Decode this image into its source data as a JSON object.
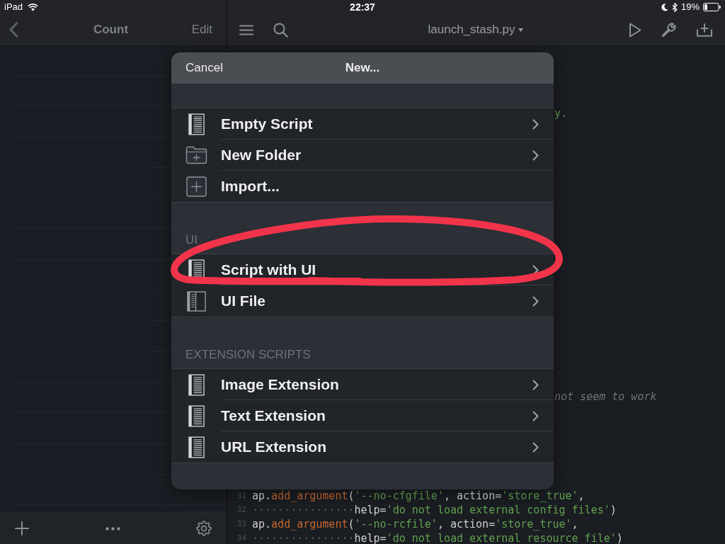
{
  "status_bar": {
    "device": "iPad",
    "time": "22:37",
    "battery": "19%"
  },
  "sidebar": {
    "title": "Count",
    "edit_button": "Edit"
  },
  "editor": {
    "file_name": "launch_stash.py",
    "fragments": [
      {
        "tokens": [
          {
            "text": "y.",
            "kind": "string"
          }
        ]
      },
      {
        "tokens": [
          {
            "text": "not seem to work",
            "kind": "comment"
          }
        ]
      }
    ],
    "lines": [
      {
        "number": "31",
        "tokens": [
          {
            "text": "ap.",
            "kind": "plain"
          },
          {
            "text": "add_argument",
            "kind": "func"
          },
          {
            "text": "(",
            "kind": "plain"
          },
          {
            "text": "'--no-cfgfile'",
            "kind": "string"
          },
          {
            "text": ", action=",
            "kind": "plain"
          },
          {
            "text": "'store_true'",
            "kind": "string"
          },
          {
            "text": ",",
            "kind": "plain"
          }
        ]
      },
      {
        "number": "32",
        "tokens": [
          {
            "text": "················",
            "kind": "whitespace"
          },
          {
            "text": "help=",
            "kind": "plain"
          },
          {
            "text": "'do not load external config files'",
            "kind": "string"
          },
          {
            "text": ")",
            "kind": "plain"
          }
        ]
      },
      {
        "number": "33",
        "tokens": [
          {
            "text": "ap.",
            "kind": "plain"
          },
          {
            "text": "add_argument",
            "kind": "func"
          },
          {
            "text": "(",
            "kind": "plain"
          },
          {
            "text": "'--no-rcfile'",
            "kind": "string"
          },
          {
            "text": ", action=",
            "kind": "plain"
          },
          {
            "text": "'store_true'",
            "kind": "string"
          },
          {
            "text": ",",
            "kind": "plain"
          }
        ]
      },
      {
        "number": "34",
        "tokens": [
          {
            "text": "················",
            "kind": "whitespace"
          },
          {
            "text": "help=",
            "kind": "plain"
          },
          {
            "text": "'do not load external resource file'",
            "kind": "string"
          },
          {
            "text": ")",
            "kind": "plain"
          }
        ]
      }
    ]
  },
  "dialog": {
    "cancel_button": "Cancel",
    "title": "New...",
    "sections": [
      {
        "items": [
          {
            "label": "Empty Script",
            "kind": "script",
            "disclosure": true
          },
          {
            "label": "New Folder",
            "kind": "folder",
            "disclosure": true
          },
          {
            "label": "Import...",
            "kind": "import",
            "disclosure": false
          }
        ]
      },
      {
        "header": "UI",
        "items": [
          {
            "label": "Script with UI",
            "kind": "script",
            "disclosure": true
          },
          {
            "label": "UI File",
            "kind": "ui_file",
            "disclosure": true
          }
        ]
      },
      {
        "header": "EXTENSION SCRIPTS",
        "items": [
          {
            "label": "Image Extension",
            "kind": "script",
            "disclosure": true
          },
          {
            "label": "Text Extension",
            "kind": "script",
            "disclosure": true
          },
          {
            "label": "URL Extension",
            "kind": "script",
            "disclosure": true
          }
        ]
      }
    ]
  }
}
